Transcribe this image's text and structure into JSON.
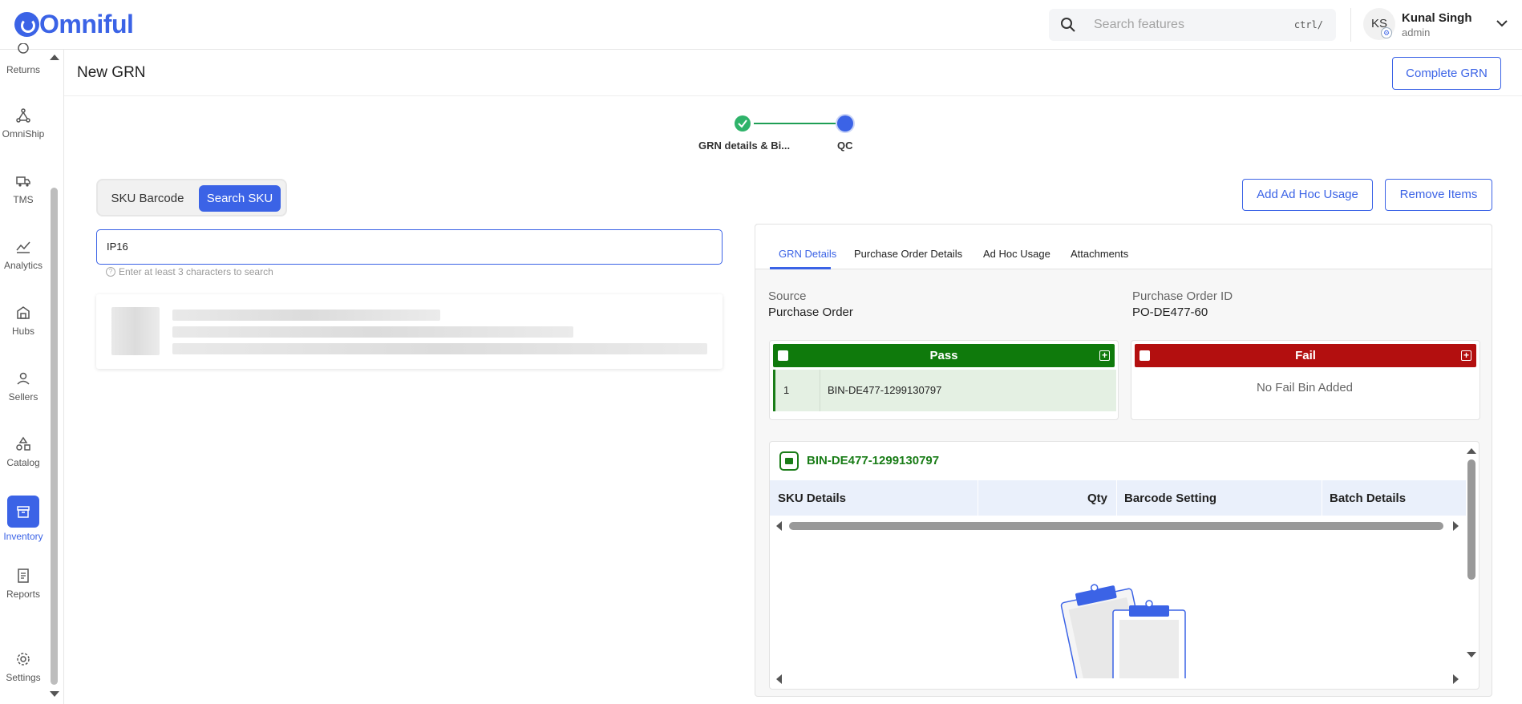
{
  "app": {
    "name": "Omniful",
    "brand_color": "#3b63e6"
  },
  "search": {
    "placeholder": "Search features",
    "shortcut": "ctrl/"
  },
  "user": {
    "initials": "KS",
    "name": "Kunal Singh",
    "role": "admin"
  },
  "sidebar": {
    "items": [
      {
        "label": "Returns",
        "icon": "returns-icon"
      },
      {
        "label": "OmniShip",
        "icon": "omniship-icon"
      },
      {
        "label": "TMS",
        "icon": "truck-icon"
      },
      {
        "label": "Analytics",
        "icon": "analytics-icon"
      },
      {
        "label": "Hubs",
        "icon": "hub-icon"
      },
      {
        "label": "Sellers",
        "icon": "user-icon"
      },
      {
        "label": "Catalog",
        "icon": "shapes-icon"
      },
      {
        "label": "Inventory",
        "icon": "archive-icon",
        "active": true
      },
      {
        "label": "Reports",
        "icon": "report-icon"
      },
      {
        "label": "Settings",
        "icon": "gear-icon"
      }
    ]
  },
  "page": {
    "title": "New GRN",
    "complete_label": "Complete GRN"
  },
  "stepper": {
    "steps": [
      {
        "label": "GRN details & Bi...",
        "state": "done"
      },
      {
        "label": "QC",
        "state": "current"
      }
    ]
  },
  "sku_toggle": {
    "options": [
      "SKU Barcode",
      "Search SKU"
    ],
    "selected": "Search SKU"
  },
  "sku_search": {
    "value": "IP16",
    "hint": "Enter at least 3 characters to search"
  },
  "actions": {
    "add_adhoc": "Add Ad Hoc Usage",
    "remove_items": "Remove Items"
  },
  "tabs": [
    "GRN Details",
    "Purchase Order Details",
    "Ad Hoc Usage",
    "Attachments"
  ],
  "active_tab": "GRN Details",
  "grn_details": {
    "source_label": "Source",
    "source_value": "Purchase Order",
    "po_label": "Purchase Order ID",
    "po_value": "PO-DE477-60"
  },
  "pass_bins": {
    "title": "Pass",
    "color": "#0f7a0c",
    "rows": [
      {
        "index": "1",
        "bin": "BIN-DE477-1299130797"
      }
    ]
  },
  "fail_bins": {
    "title": "Fail",
    "color": "#b30f0f",
    "empty_text": "No Fail Bin Added"
  },
  "bin_detail": {
    "title": "BIN-DE477-1299130797",
    "columns": [
      "SKU Details",
      "Qty",
      "Barcode Setting",
      "Batch Details"
    ]
  }
}
